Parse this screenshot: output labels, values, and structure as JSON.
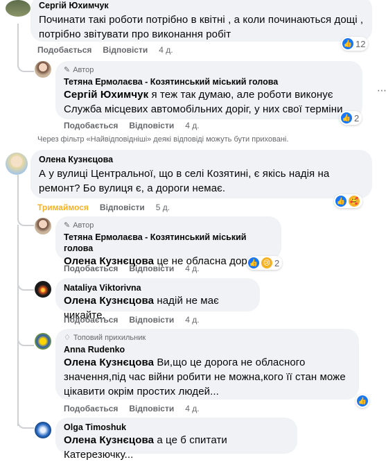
{
  "colors": {
    "bubble": "#f0f2f5",
    "meta_text": "#65676b",
    "like_blue": "#1877f2",
    "haha_yellow": "#f7b125",
    "sad_yellow": "#f7b125"
  },
  "comments": [
    {
      "author": "Сергій Юхимчук",
      "text": "Починати такі роботи потрібно в квітні , а коли починаються дощі , потрібно звітувати про виконання робіт",
      "like_label": "Подобається",
      "reply_label": "Відповісти",
      "time": "4 д.",
      "reaction_count": "12",
      "reaction_icons": [
        "like-icon"
      ]
    },
    {
      "badge": "Автор",
      "author": "Тетяна Ермолаєва - Козятинський міський голова",
      "mention": "Сергій Юхимчук",
      "text": " я теж так думаю, але роботи виконує Служба місцевих автомобільних доріг, у них свої терміни .",
      "like_label": "Подобається",
      "reply_label": "Відповісти",
      "time": "4 д.",
      "reaction_count": "2",
      "reaction_icons": [
        "like-icon"
      ]
    },
    {
      "filter_note": "Через фільтр «Найвідповідніші» деякі відповіді можуть бути приховані."
    },
    {
      "author": "Олена Кузнєцова",
      "text": "А у вулиці Центральної, що в селі Козятині, є якісь надія на ремонт? Бо вулиця є, а дороги немає.",
      "like_label": "Тримаймося",
      "reply_label": "Відповісти",
      "time": "5 д.",
      "reaction_icons": [
        "like-icon",
        "care-icon"
      ]
    },
    {
      "badge": "Автор",
      "author": "Тетяна Ермолаєва - Козятинський міський голова",
      "mention": "Олена Кузнєцова",
      "text": " це не обласна дорога.",
      "like_label": "Подобається",
      "reply_label": "Відповісти",
      "time": "4 д.",
      "reaction_count": "2",
      "reaction_icons": [
        "like-icon",
        "sad-icon"
      ]
    },
    {
      "author": "Nataliya Viktorivna",
      "mention": "Олена Кузнєцова",
      "text": " надій не має чикайте.",
      "like_label": "Подобається",
      "reply_label": "Відповісти",
      "time": "4 д."
    },
    {
      "badge": "Топовий прихильник",
      "author": "Anna Rudenko",
      "mention": "Олена Кузнєцова",
      "text": " Ви,що це дорога не обласного значення,під час війни робити не можна,кого її стан може цікавити окрім простих людей...",
      "like_label": "Подобається",
      "reply_label": "Відповісти",
      "time": "4 д.",
      "reaction_icons": [
        "like-icon"
      ]
    },
    {
      "author": "Olga Timoshuk",
      "mention": "Олена Кузнєцова",
      "text": " а це б спитати Катерезючку..."
    }
  ]
}
